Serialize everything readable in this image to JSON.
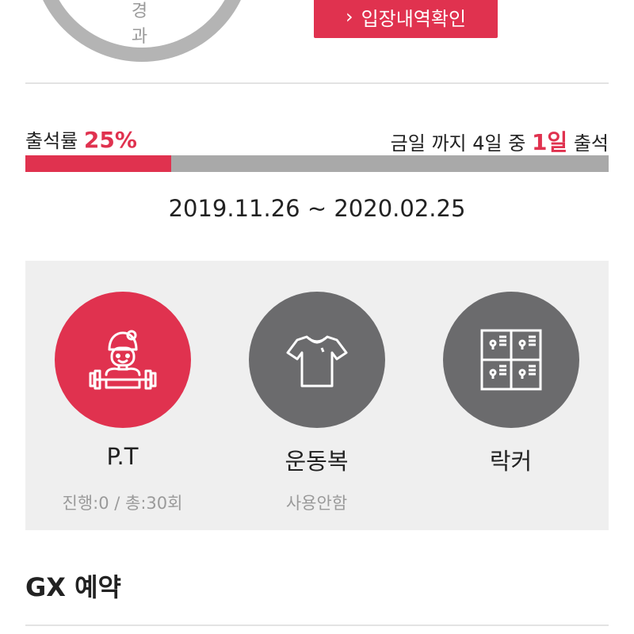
{
  "top": {
    "ring_label": "경과",
    "entry_button_label": "입장내역확인"
  },
  "attendance": {
    "label": "출석률",
    "rate": "25%",
    "rate_fraction": 0.25,
    "summary_prefix": "금일 까지 4일 중",
    "summary_days": "1일",
    "summary_suffix": "출석"
  },
  "period": "2019.11.26 ~ 2020.02.25",
  "services": [
    {
      "name": "P.T",
      "sub": "진행:0 / 총:30회",
      "icon": "trainer-barbell-icon",
      "active": true
    },
    {
      "name": "운동복",
      "sub": "사용안함",
      "icon": "tshirt-icon",
      "active": false
    },
    {
      "name": "락커",
      "sub": "",
      "icon": "locker-icon",
      "active": false
    }
  ],
  "gx": {
    "title": "GX 예약"
  },
  "colors": {
    "accent": "#e0324f",
    "inactive_circle": "#6b6b6d",
    "progress_track": "#a9a9a9",
    "panel_bg": "#efefef"
  }
}
